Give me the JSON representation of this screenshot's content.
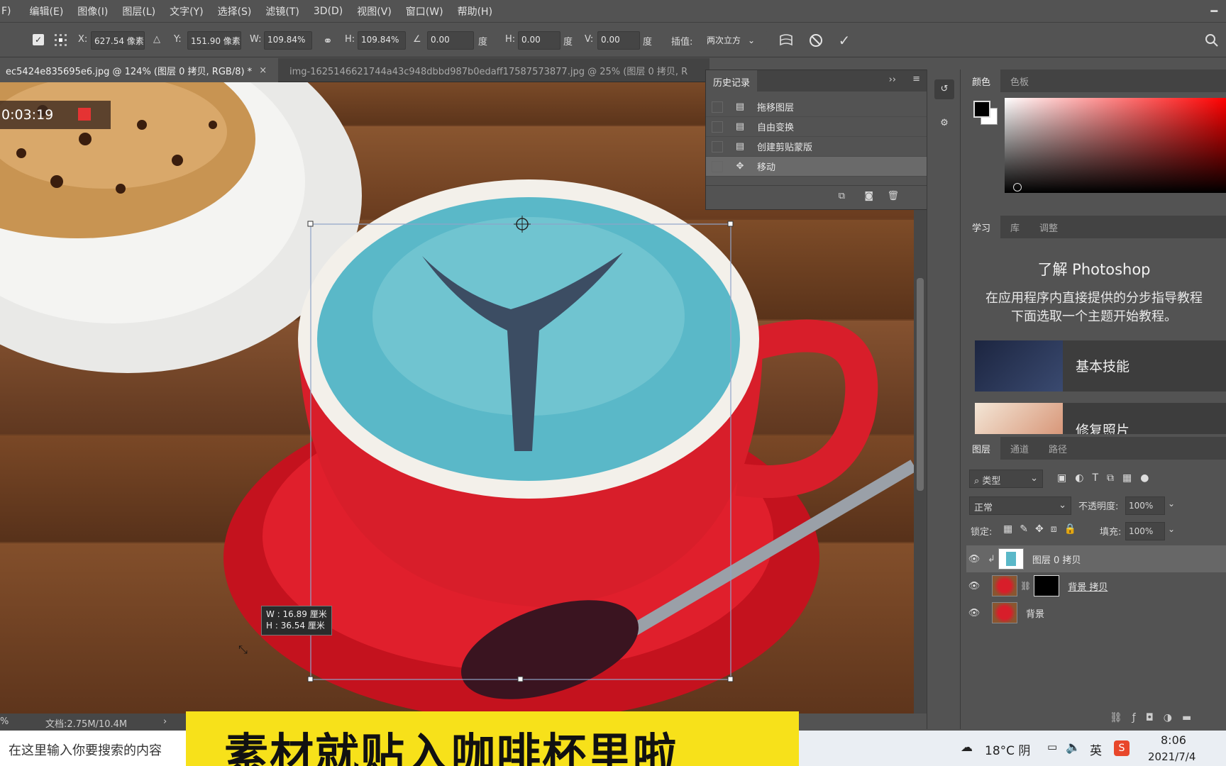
{
  "menu": {
    "items": [
      "F)",
      "编辑(E)",
      "图像(I)",
      "图层(L)",
      "文字(Y)",
      "选择(S)",
      "滤镜(T)",
      "3D(D)",
      "视图(V)",
      "窗口(W)",
      "帮助(H)"
    ]
  },
  "options": {
    "x_label": "X:",
    "x_value": "627.54 像素",
    "y_label": "Y:",
    "y_value": "151.90 像素",
    "w_label": "W:",
    "w_value": "109.84%",
    "h_label": "H:",
    "h_value": "109.84%",
    "angle_value": "0.00",
    "deg": "度",
    "hskew_label": "H:",
    "hskew_value": "0.00",
    "vskew_label": "V:",
    "vskew_value": "0.00",
    "interp_label": "插值:",
    "interp_value": "两次立方"
  },
  "tabs": [
    {
      "label": "ec5424e835695e6.jpg @ 124% (图层 0 拷贝, RGB/8) *",
      "close": "×"
    },
    {
      "label": "img-1625146621744a43c948dbbd987b0edaff17587573877.jpg @ 25% (图层 0 拷贝, R"
    }
  ],
  "canvas": {
    "timer": "0:03:19",
    "transform_tooltip_w": "W : 16.89 厘米",
    "transform_tooltip_h": "H : 36.54 厘米"
  },
  "status": {
    "doc": "文档:2.75M/10.4M",
    "zoom": "%",
    "arrow": "›"
  },
  "history": {
    "title": "历史记录",
    "items": [
      {
        "label": "拖移图层"
      },
      {
        "label": "自由变换"
      },
      {
        "label": "创建剪贴蒙版"
      },
      {
        "label": "移动"
      }
    ]
  },
  "color_panel": {
    "tab_color": "颜色",
    "tab_swatches": "色板"
  },
  "learn_panel": {
    "tab_learn": "学习",
    "tab_library": "库",
    "tab_adjust": "调整",
    "title": "了解 Photoshop",
    "desc1": "在应用程序内直接提供的分步指导教程",
    "desc2": "下面选取一个主题开始教程。",
    "cards": [
      {
        "label": "基本技能"
      },
      {
        "label": "修复照片"
      }
    ]
  },
  "layers_panel": {
    "tab_layers": "图层",
    "tab_channels": "通道",
    "tab_paths": "路径",
    "filter_kind": "类型",
    "blend_mode": "正常",
    "opacity_label": "不透明度:",
    "opacity_value": "100%",
    "lock_label": "锁定:",
    "fill_label": "填充:",
    "fill_value": "100%",
    "layers": [
      {
        "name": "图层 0 拷贝"
      },
      {
        "name": "背景 拷贝"
      },
      {
        "name": "背景"
      }
    ]
  },
  "taskbar": {
    "search_placeholder": "在这里输入你要搜索的内容",
    "caption": "素材就贴入咖啡杯里啦",
    "weather": "18°C  阴",
    "ime": "英",
    "time": "8:06",
    "date": "2021/7/4"
  },
  "colors": {
    "ui_bg": "#535353",
    "panel_dark": "#434343",
    "caption_bg": "#f7e11a",
    "record": "#e53333",
    "cup_red": "#d81e2a",
    "water": "#5ab8c8"
  }
}
